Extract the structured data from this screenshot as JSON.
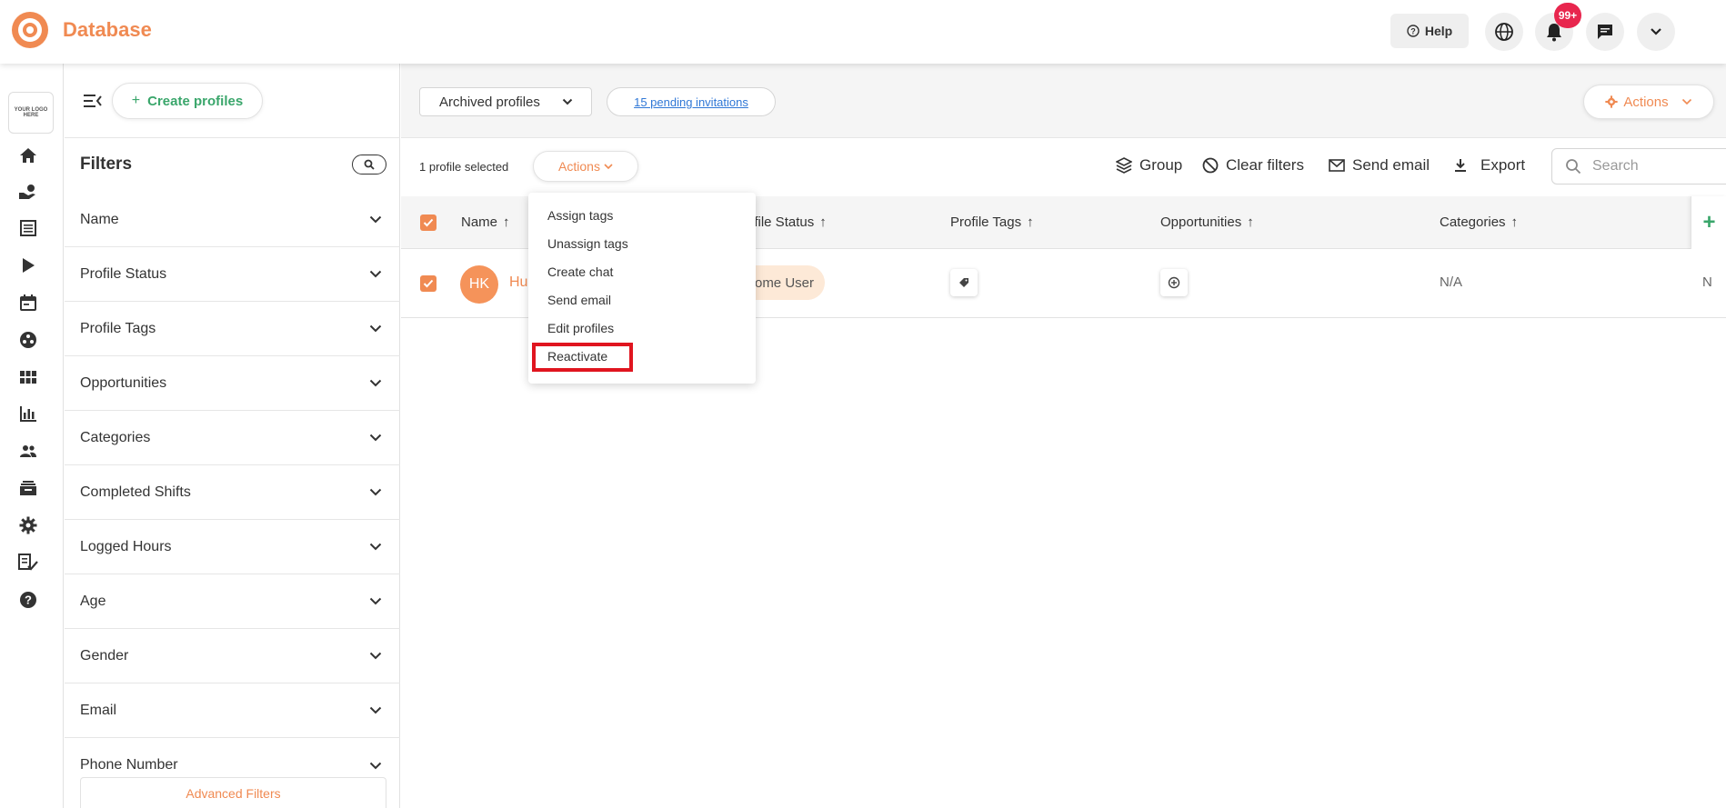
{
  "header": {
    "brand": "Database",
    "help_label": "Help",
    "notification_badge": "99+"
  },
  "rail": {
    "logo_text": "YOUR LOGO HERE",
    "icons": [
      "home-icon",
      "volunteer-icon",
      "list-icon",
      "play-icon",
      "calendar-icon",
      "group-circle-icon",
      "grid-icon",
      "chart-icon",
      "people-icon",
      "inbox-icon",
      "gear-icon",
      "checklist-icon",
      "help-icon"
    ]
  },
  "filters": {
    "create_label": "Create profiles",
    "title": "Filters",
    "items": [
      "Name",
      "Profile Status",
      "Profile Tags",
      "Opportunities",
      "Categories",
      "Completed Shifts",
      "Logged Hours",
      "Age",
      "Gender",
      "Email",
      "Phone Number"
    ],
    "advanced_label": "Advanced Filters"
  },
  "main": {
    "view_select": "Archived profiles",
    "pending_link": "15 pending invitations",
    "actions_label": "Actions",
    "selected_count": "1 profile selected",
    "toolbar_actions_label": "Actions",
    "tools": {
      "group": "Group",
      "clear_filters": "Clear filters",
      "send_email": "Send email",
      "export": "Export"
    },
    "search_placeholder": "Search",
    "columns": [
      "Name",
      "Profile Status",
      "Profile Tags",
      "Opportunities",
      "Categories"
    ],
    "columns_visible": {
      "name": "Name",
      "status": "ofile Status",
      "tags": "Profile Tags",
      "opportunities": "Opportunities",
      "categories": "Categories"
    },
    "add_column": "+",
    "row": {
      "initials": "HK",
      "name": "Hu",
      "status": "Vome User",
      "categories": "N/A",
      "cut_value": "N"
    }
  },
  "menu": {
    "items": [
      "Assign tags",
      "Unassign tags",
      "Create chat",
      "Send email",
      "Edit profiles",
      "Reactivate"
    ],
    "highlighted": "Reactivate"
  },
  "colors": {
    "accent": "#f08a52",
    "green": "#3aa66b",
    "link": "#2f77d6",
    "badge": "#e8264e",
    "highlight": "#e0151f"
  }
}
